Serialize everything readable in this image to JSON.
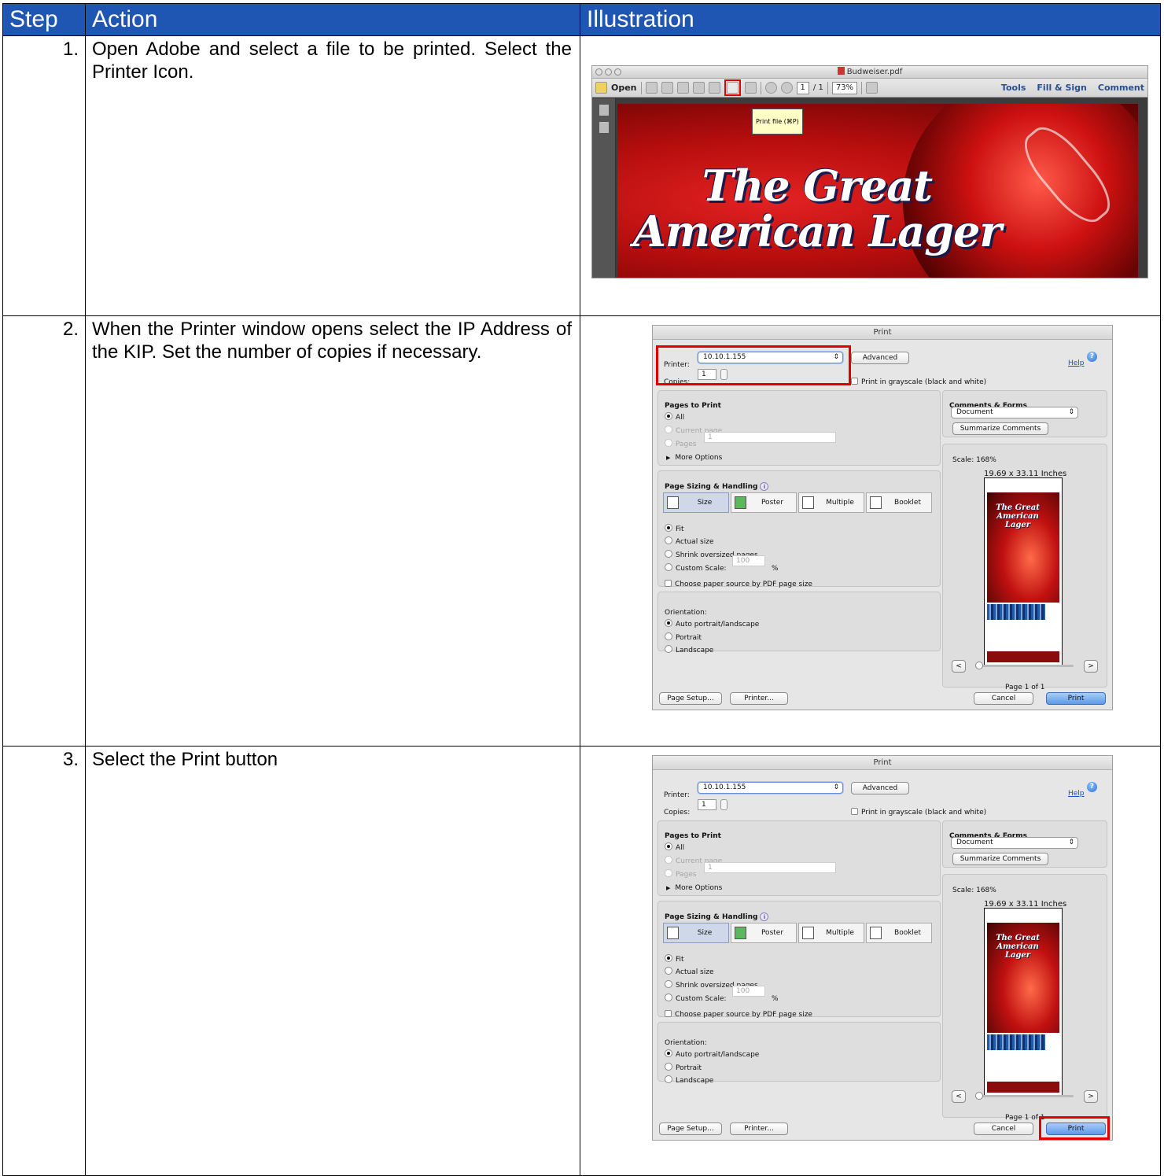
{
  "table": {
    "headers": [
      "Step",
      "Action",
      "Illustration"
    ],
    "rows": [
      {
        "num": "1.",
        "action": "Open Adobe and select a file to be printed. Select the Printer Icon."
      },
      {
        "num": "2.",
        "action": "When the Printer window opens select the IP Address of the KIP. Set the number of copies if necessary."
      },
      {
        "num": "3.",
        "action": "Select the Print button"
      }
    ]
  },
  "reader": {
    "window_title": "Budweiser.pdf",
    "open_label": "Open",
    "page_current": "1",
    "page_total": "/ 1",
    "zoom": "73%",
    "tools_label": "Tools",
    "fill_sign_label": "Fill & Sign",
    "comment_label": "Comment",
    "tooltip": "Print file (⌘P)",
    "document_heading_line1": "The Great",
    "document_heading_line2": "American Lager"
  },
  "dialog": {
    "title": "Print",
    "printer_label": "Printer:",
    "printer_value": "10.10.1.155",
    "advanced_label": "Advanced",
    "help_label": "Help",
    "copies_label": "Copies:",
    "copies_value": "1",
    "grayscale_label": "Print in grayscale (black and white)",
    "pages_to_print_title": "Pages to Print",
    "all_label": "All",
    "current_page_label": "Current page",
    "pages_label": "Pages",
    "pages_value": "1",
    "more_options_label": "More Options",
    "comments_forms_title": "Comments & Forms",
    "comments_value": "Document",
    "summarize_label": "Summarize Comments",
    "scale_label": "Scale: 168%",
    "dimensions_label": "19.69 x 33.11 Inches",
    "sizing_title": "Page Sizing & Handling",
    "tab_size": "Size",
    "tab_poster": "Poster",
    "tab_multiple": "Multiple",
    "tab_booklet": "Booklet",
    "fit_label": "Fit",
    "actual_size_label": "Actual size",
    "shrink_label": "Shrink oversized pages",
    "custom_scale_label": "Custom Scale:",
    "custom_scale_value": "100",
    "percent_label": "%",
    "paper_source_label": "Choose paper source by PDF page size",
    "orientation_title": "Orientation:",
    "auto_label": "Auto portrait/landscape",
    "portrait_label": "Portrait",
    "landscape_label": "Landscape",
    "page_of_label": "Page 1 of 1",
    "page_setup_label": "Page Setup...",
    "printer_button_label": "Printer...",
    "cancel_label": "Cancel",
    "print_label": "Print",
    "preview_heading_line1": "The Great",
    "preview_heading_line2": "American Lager"
  },
  "colors": {
    "header_bg": "#1f55b3",
    "highlight": "#e00000"
  }
}
